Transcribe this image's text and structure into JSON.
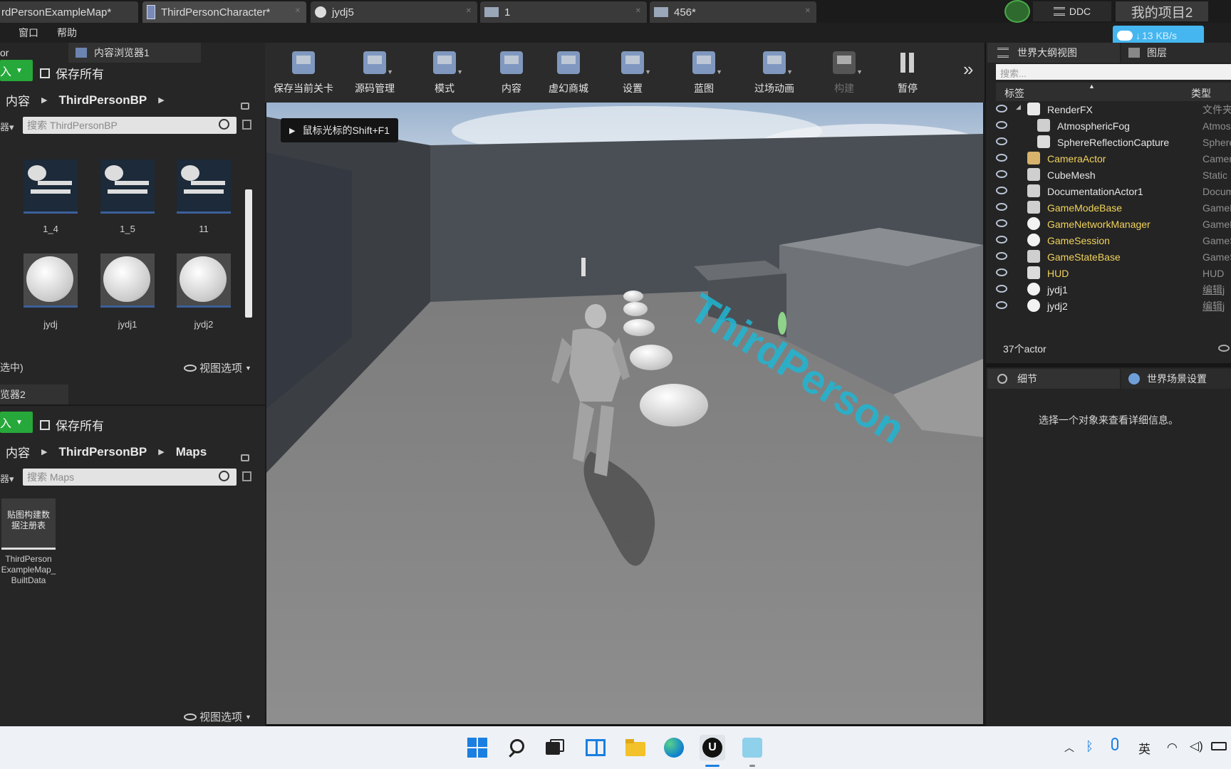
{
  "tabs": [
    {
      "label": "rdPersonExampleMap*",
      "active": false
    },
    {
      "label": "ThirdPersonCharacter*",
      "active": true
    },
    {
      "label": "jydj5",
      "active": false
    },
    {
      "label": "1",
      "active": false
    },
    {
      "label": "456*",
      "active": false
    }
  ],
  "topright": {
    "ddc_label": "DDC",
    "project_name": "我的项目2",
    "net_speed": "13 KB/s"
  },
  "menu": [
    "窗口",
    "帮助"
  ],
  "left": {
    "tab_partial": "or",
    "browser1_tab": "内容浏览器1",
    "import_label": "入",
    "save_all": "保存所有",
    "breadcrumb1": [
      "内容",
      "ThirdPersonBP"
    ],
    "search1_placeholder": "搜索 ThirdPersonBP",
    "assets_row1": [
      "1_4",
      "1_5",
      "11"
    ],
    "assets_row2": [
      "jydj",
      "jydj1",
      "jydj2"
    ],
    "selected_status": "选中)",
    "view_options": "视图选项",
    "browser2_tab": "览器2",
    "breadcrumb2": [
      "内容",
      "ThirdPersonBP",
      "Maps"
    ],
    "search2_placeholder": "搜索 Maps",
    "builtdata_thumb": "贴图构建数据注册表",
    "builtdata_label": "ThirdPerson ExampleMap_ BuiltData"
  },
  "toolbar": [
    {
      "label": "保存当前关卡",
      "icon": "save-icon",
      "drop": false,
      "disabled": false
    },
    {
      "label": "源码管理",
      "icon": "source-control-icon",
      "drop": true,
      "disabled": false
    },
    {
      "label": "模式",
      "icon": "modes-icon",
      "drop": true,
      "disabled": false
    },
    {
      "label": "内容",
      "icon": "content-icon",
      "drop": false,
      "disabled": false
    },
    {
      "label": "虚幻商城",
      "icon": "marketplace-icon",
      "drop": false,
      "disabled": false
    },
    {
      "label": "设置",
      "icon": "settings-icon",
      "drop": true,
      "disabled": false
    },
    {
      "label": "蓝图",
      "icon": "blueprint-icon",
      "drop": true,
      "disabled": false
    },
    {
      "label": "过场动画",
      "icon": "cinematics-icon",
      "drop": true,
      "disabled": false
    },
    {
      "label": "构建",
      "icon": "build-icon",
      "drop": true,
      "disabled": true
    },
    {
      "label": "暂停",
      "icon": "pause-icon",
      "drop": false,
      "disabled": false
    }
  ],
  "viewport": {
    "hint": "鼠标光标的Shift+F1",
    "floor_text": "ThirdPerson"
  },
  "outliner": {
    "tab_label": "世界大纲视图",
    "layers_tab": "图层",
    "search_placeholder": "搜索...",
    "col_label": "标签",
    "col_type": "类型",
    "rows": [
      {
        "name": "RenderFX",
        "type": "文件夹",
        "color": "white",
        "indent": 0,
        "icon": "folder-icon",
        "expand": true
      },
      {
        "name": "AtmosphericFog",
        "type": "Atmos",
        "color": "white",
        "indent": 1,
        "icon": "fog-icon"
      },
      {
        "name": "SphereReflectionCapture",
        "type": "Sphere",
        "color": "white",
        "indent": 1,
        "icon": "reflection-icon"
      },
      {
        "name": "CameraActor",
        "type": "Camer",
        "color": "yellow",
        "indent": 0,
        "icon": "camera-icon"
      },
      {
        "name": "CubeMesh",
        "type": "Static",
        "color": "white",
        "indent": 0,
        "icon": "mesh-icon"
      },
      {
        "name": "DocumentationActor1",
        "type": "Docum",
        "color": "white",
        "indent": 0,
        "icon": "doc-icon"
      },
      {
        "name": "GameModeBase",
        "type": "GameM",
        "color": "yellow",
        "indent": 0,
        "icon": "gamemode-icon"
      },
      {
        "name": "GameNetworkManager",
        "type": "GameN",
        "color": "yellow",
        "indent": 0,
        "icon": "actor-icon"
      },
      {
        "name": "GameSession",
        "type": "GameS",
        "color": "yellow",
        "indent": 0,
        "icon": "actor-icon"
      },
      {
        "name": "GameStateBase",
        "type": "GameS",
        "color": "yellow",
        "indent": 0,
        "icon": "gamestate-icon"
      },
      {
        "name": "HUD",
        "type": "HUD",
        "color": "yellow",
        "indent": 0,
        "icon": "hud-icon"
      },
      {
        "name": "jydj1",
        "type": "编辑j",
        "color": "white",
        "indent": 0,
        "icon": "actor-icon",
        "link": true
      },
      {
        "name": "jydj2",
        "type": "编辑j",
        "color": "white",
        "indent": 0,
        "icon": "actor-icon",
        "link": true
      }
    ],
    "count": "37个actor"
  },
  "details": {
    "tab_label": "细节",
    "world_tab": "世界场景设置",
    "empty_msg": "选择一个对象来查看详细信息。"
  },
  "tray": {
    "ime": "英"
  },
  "colors": {
    "accent_green": "#27a83a",
    "outliner_yellow": "#f2d35b",
    "link_blue": "#4a90ea",
    "floor_text_cyan": "#1fb6d4"
  }
}
